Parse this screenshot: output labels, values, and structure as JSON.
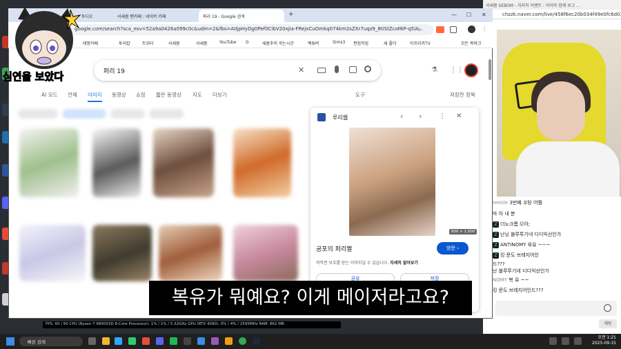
{
  "chrome": {
    "tabs": [
      "투디오",
      "서새봄 팬카페 : 네이버 카페",
      "퍼리 19 - Google 검색"
    ],
    "new_tab": "+",
    "url": "google.com/search?sca_esv=52a9a0426a099c0c&udm=2&fbs=AIIjpHyDg0Pef0CibV20xjIa-FRejxCuOmkq074km2sZXr7uqz9_8tiStZcoMiP-q5iA...",
    "bookmarks": [
      "태봉카페",
      "투리캅",
      "트위터",
      "서새봄",
      "서새봄",
      "YouTube",
      "G",
      "새봄추의 쉬는시간",
      "벡튜버",
      "Sims3",
      "편집작업",
      "새 폴더",
      "아프리카TV",
      "모든 북마크"
    ]
  },
  "google": {
    "query": "퍼리 19",
    "tabs": [
      "AI 모드",
      "전체",
      "이미지",
      "동영상",
      "쇼핑",
      "짧은 동영상",
      "지도",
      "더보기"
    ],
    "tools": "도구",
    "saved": "저장한 항목",
    "panel": {
      "source": "루리웹",
      "size": "800 × 1,000",
      "title": "공포의 퍼리짤",
      "notice": "저작권 보호를 받는 이미지일 수 있습니다.",
      "more": "자세히 알아보기",
      "visit": "방문",
      "share": "공유",
      "save": "저장"
    }
  },
  "chat": {
    "title": "서새봄 SEBOM - 치지직 이벤트  : 아이와 함께 보고 ...",
    "url": "chzzk.naver.com/live/458f6ec20b034f49e0fc6d039216...",
    "messages": [
      {
        "nick": "temile",
        "text": "3번째 꼬탕 어쩜"
      },
      {
        "nick": "",
        "text": "마 아 내 분"
      },
      {
        "nick": "",
        "text": "더노크롬 으아;"
      },
      {
        "nick": "",
        "text": "난닝 블루투기네 디디익선인가"
      },
      {
        "nick": "",
        "text": "ANTINOMY 육유 ~~~"
      },
      {
        "nick": "",
        "text": "킹 문도 브레지어인"
      },
      {
        "nick": "",
        "text": "드???"
      },
      {
        "nick": "",
        "text": "난 블루투기네 디디익선인가"
      },
      {
        "nick": "NOMY",
        "text": "복 유 ~~"
      },
      {
        "nick": "",
        "text": "킹 문도 브레지어인드???"
      }
    ],
    "send": "채팅"
  },
  "perf": "FPS: 60 / 60    CPU (Ryzen 7 9800X3D 8-Core Processor): 1% / 1% / 5.32GHz    GPU (RTX 4090): 0% / 4% / 2595MHz    RAM: 862 MB",
  "taskbar": {
    "search": "빠른 검색",
    "time": "오전 1:21",
    "date": "2025-09-15"
  },
  "sticker": "심연을 보았다",
  "subtitle": "복유가 뭐예요? 이게 메이저라고요?",
  "colors": {
    "accent": "#1a73e8",
    "visit": "#0b57d0",
    "tabbar": "#d9e2f0",
    "chair": "#e4d92c"
  }
}
